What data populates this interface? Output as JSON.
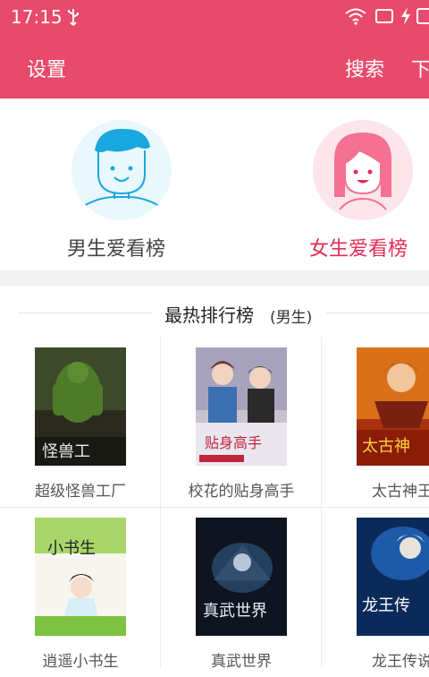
{
  "status_bar": {
    "time": "17:15",
    "icons": [
      "usb-icon",
      "wifi-icon",
      "screen-rotate-icon",
      "charging-bolt-icon",
      "battery-icon"
    ]
  },
  "app_bar": {
    "settings_label": "设置",
    "search_label": "搜索",
    "download_label": "下",
    "background": "#e84a6b"
  },
  "gender_tabs": {
    "male_label": "男生爱看榜",
    "female_label": "女生爱看榜",
    "active_color": "#e32c56"
  },
  "ranking": {
    "title": "最热排行榜",
    "subtitle": "(男生)"
  },
  "books": [
    {
      "title": "超级怪兽工厂",
      "cover_text": "怪兽工"
    },
    {
      "title": "校花的贴身高手",
      "cover_text": "贴身高手"
    },
    {
      "title": "太古神王",
      "cover_text": "太古神"
    },
    {
      "title": "逍遥小书生",
      "cover_text": "小书生"
    },
    {
      "title": "真武世界",
      "cover_text": "真武世界"
    },
    {
      "title": "龙王传说",
      "cover_text": "龙王传"
    }
  ]
}
